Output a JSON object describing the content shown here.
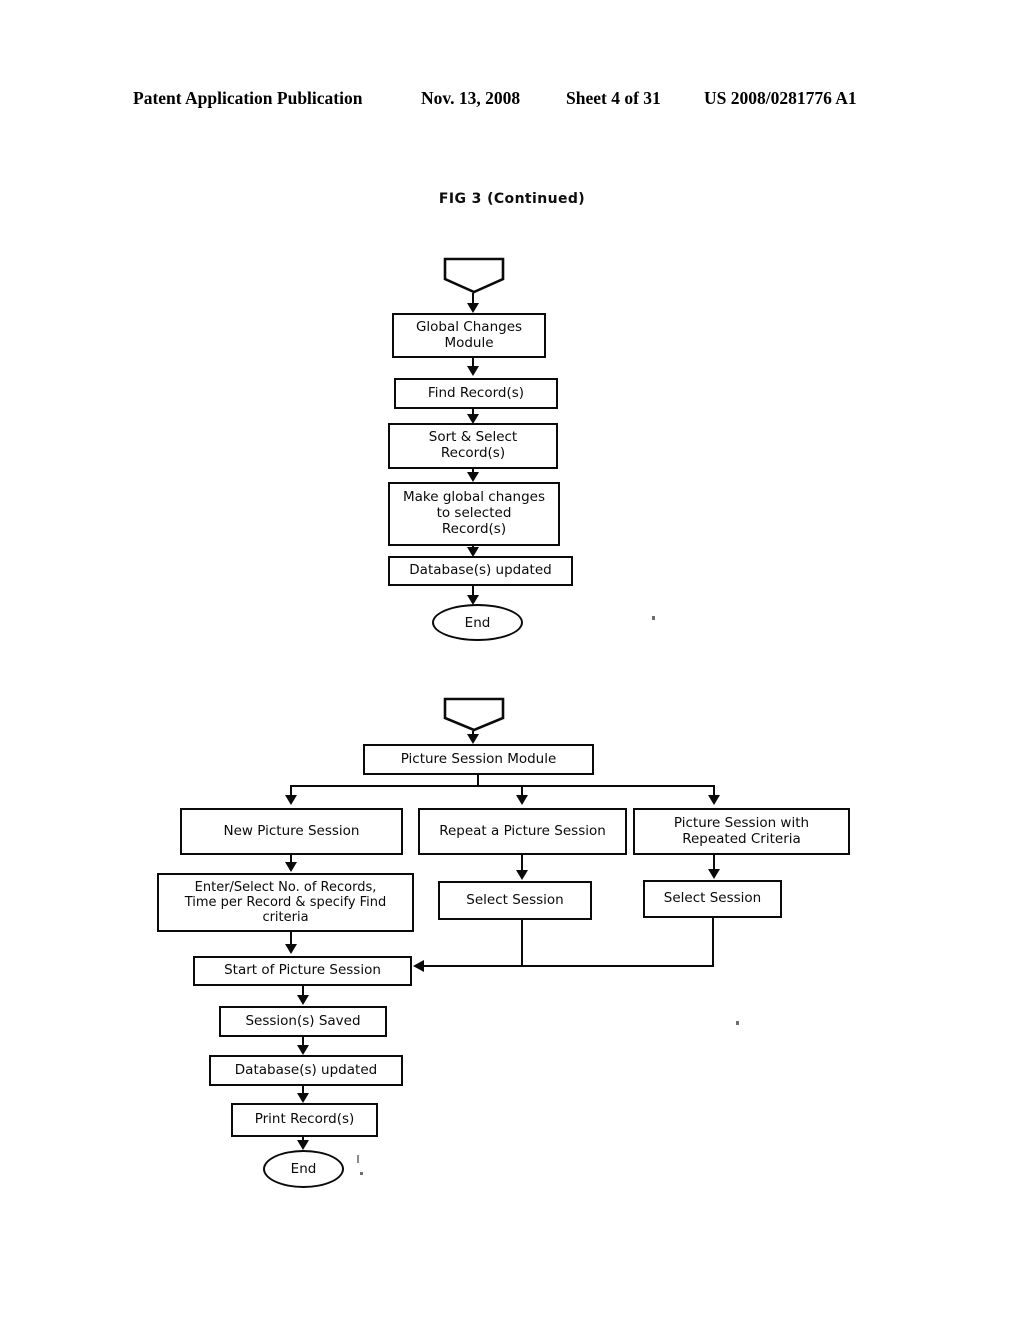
{
  "header": {
    "publication": "Patent Application Publication",
    "date": "Nov. 13, 2008",
    "sheet": "Sheet 4 of 31",
    "patent_number": "US 2008/0281776 A1"
  },
  "figure": {
    "title": "FIG 3 (Continued)"
  },
  "diagram_data": {
    "type": "flowchart",
    "charts": [
      {
        "id": "global-changes-flow",
        "nodes": [
          {
            "id": "gc-start",
            "shape": "pentagon-connector",
            "label": ""
          },
          {
            "id": "gc-module",
            "shape": "process",
            "label": "Global Changes\nModule"
          },
          {
            "id": "gc-find",
            "shape": "process",
            "label": "Find Record(s)"
          },
          {
            "id": "gc-sort",
            "shape": "process",
            "label": "Sort & Select\nRecord(s)"
          },
          {
            "id": "gc-make",
            "shape": "process",
            "label": "Make global changes\nto selected\nRecord(s)"
          },
          {
            "id": "gc-db",
            "shape": "process",
            "label": "Database(s) updated"
          },
          {
            "id": "gc-end",
            "shape": "terminator",
            "label": "End"
          }
        ],
        "edges": [
          {
            "from": "gc-start",
            "to": "gc-module"
          },
          {
            "from": "gc-module",
            "to": "gc-find"
          },
          {
            "from": "gc-find",
            "to": "gc-sort"
          },
          {
            "from": "gc-sort",
            "to": "gc-make"
          },
          {
            "from": "gc-make",
            "to": "gc-db"
          },
          {
            "from": "gc-db",
            "to": "gc-end"
          }
        ]
      },
      {
        "id": "picture-session-flow",
        "nodes": [
          {
            "id": "ps-start",
            "shape": "pentagon-connector",
            "label": ""
          },
          {
            "id": "ps-module",
            "shape": "process",
            "label": "Picture Session Module"
          },
          {
            "id": "ps-new",
            "shape": "process",
            "label": "New Picture Session"
          },
          {
            "id": "ps-repeat",
            "shape": "process",
            "label": "Repeat a Picture Session"
          },
          {
            "id": "ps-criteria",
            "shape": "process",
            "label": "Picture Session with\nRepeated Criteria"
          },
          {
            "id": "ps-enter",
            "shape": "process",
            "label": "Enter/Select No. of Records,\nTime per Record & specify Find\ncriteria"
          },
          {
            "id": "ps-select-1",
            "shape": "process",
            "label": "Select Session"
          },
          {
            "id": "ps-select-2",
            "shape": "process",
            "label": "Select Session"
          },
          {
            "id": "ps-startsess",
            "shape": "process",
            "label": "Start of Picture Session"
          },
          {
            "id": "ps-saved",
            "shape": "process",
            "label": "Session(s) Saved"
          },
          {
            "id": "ps-db",
            "shape": "process",
            "label": "Database(s) updated"
          },
          {
            "id": "ps-print",
            "shape": "process",
            "label": "Print Record(s)"
          },
          {
            "id": "ps-end",
            "shape": "terminator",
            "label": "End"
          }
        ],
        "edges": [
          {
            "from": "ps-start",
            "to": "ps-module"
          },
          {
            "from": "ps-module",
            "to": "ps-new"
          },
          {
            "from": "ps-module",
            "to": "ps-repeat"
          },
          {
            "from": "ps-module",
            "to": "ps-criteria"
          },
          {
            "from": "ps-new",
            "to": "ps-enter"
          },
          {
            "from": "ps-repeat",
            "to": "ps-select-1"
          },
          {
            "from": "ps-criteria",
            "to": "ps-select-2"
          },
          {
            "from": "ps-enter",
            "to": "ps-startsess"
          },
          {
            "from": "ps-select-1",
            "to": "ps-startsess"
          },
          {
            "from": "ps-select-2",
            "to": "ps-startsess"
          },
          {
            "from": "ps-startsess",
            "to": "ps-saved"
          },
          {
            "from": "ps-saved",
            "to": "ps-db"
          },
          {
            "from": "ps-db",
            "to": "ps-print"
          },
          {
            "from": "ps-print",
            "to": "ps-end"
          }
        ]
      }
    ]
  },
  "chart1": {
    "module": "Global Changes\nModule",
    "find": "Find Record(s)",
    "sort": "Sort & Select\nRecord(s)",
    "make": "Make global changes\nto selected\nRecord(s)",
    "db": "Database(s) updated",
    "end": "End"
  },
  "chart2": {
    "module": "Picture Session Module",
    "new": "New Picture Session",
    "repeat": "Repeat a Picture Session",
    "criteria": "Picture Session with\nRepeated Criteria",
    "enter": "Enter/Select No. of Records,\nTime per Record & specify Find\ncriteria",
    "select1": "Select Session",
    "select2": "Select Session",
    "startsess": "Start of Picture Session",
    "saved": "Session(s) Saved",
    "db": "Database(s) updated",
    "print": "Print Record(s)",
    "end": "End"
  }
}
